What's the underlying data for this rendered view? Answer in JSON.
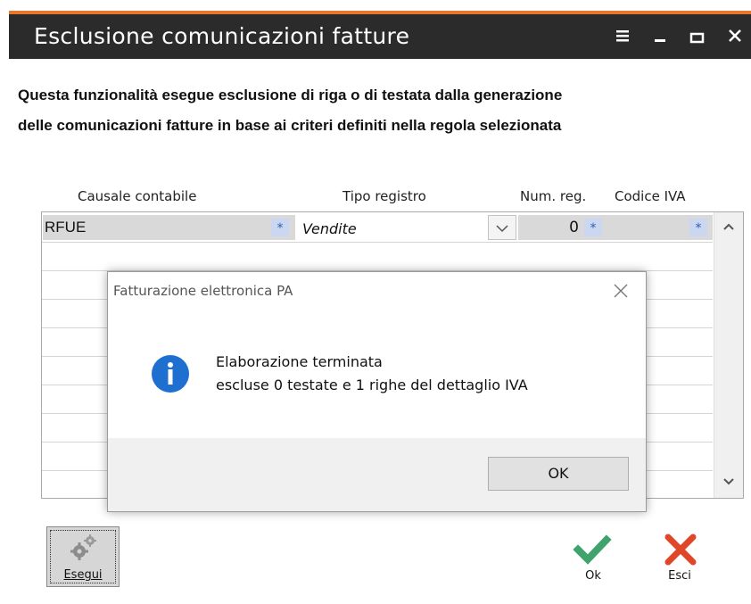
{
  "window": {
    "title": "Esclusione comunicazioni fatture"
  },
  "description": {
    "line1": "Questa funzionalità esegue esclusione di riga o di testata dalla generazione",
    "line2": "delle comunicazioni fatture in base ai criteri definiti nella regola selezionata"
  },
  "grid": {
    "columns": [
      "Causale contabile",
      "Tipo registro",
      "Num. reg.",
      "Codice IVA"
    ],
    "rows": [
      {
        "causale": "RFUE",
        "tipo_registro": "Vendite",
        "num_reg": "0",
        "codice_iva": ""
      }
    ],
    "lookup_symbol": "*"
  },
  "dialog": {
    "title": "Fatturazione elettronica PA",
    "message_line1": "Elaborazione terminata",
    "message_line2": "escluse 0 testate e 1 righe del dettaglio IVA",
    "ok_label": "OK",
    "icon": "info-icon"
  },
  "actions": {
    "esegui_label": "Esegui",
    "ok_label": "Ok",
    "esci_label": "Esci"
  },
  "colors": {
    "accent": "#e8772e",
    "titlebar": "#2b2b2b",
    "ok_green": "#3fa36b",
    "esci_red": "#e0462a",
    "info_blue": "#1f6fd0"
  }
}
